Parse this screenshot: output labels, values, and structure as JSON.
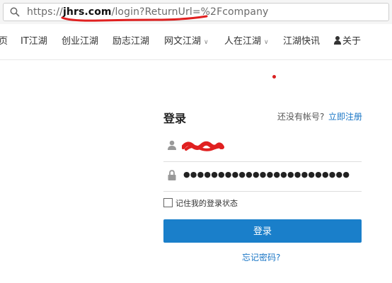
{
  "address_bar": {
    "protocol": "https://",
    "host": "jhrs.com",
    "path": "/login?ReturnUrl=%2Fcompany",
    "icon": "search-icon"
  },
  "nav": {
    "items": [
      {
        "label": "页"
      },
      {
        "label": "IT江湖"
      },
      {
        "label": "创业江湖"
      },
      {
        "label": "励志江湖"
      },
      {
        "label": "网文江湖",
        "dropdown": true
      },
      {
        "label": "人在江湖",
        "dropdown": true
      },
      {
        "label": "江湖快讯"
      },
      {
        "label": "关于",
        "icon": "user-icon"
      }
    ]
  },
  "login": {
    "title": "登录",
    "no_account_text": "还没有帐号?",
    "register_link": "立即注册",
    "username_icon": "user-icon",
    "password_icon": "lock-icon",
    "password_value": "●●●●●●●●●●●●●●●●●●●●●●●●",
    "remember_label": "记住我的登录状态",
    "remember_checked": false,
    "submit_label": "登录",
    "forgot_link": "忘记密码?"
  },
  "colors": {
    "accent": "#1a7fca",
    "link": "#1976c6",
    "annotation_red": "#e02020"
  }
}
